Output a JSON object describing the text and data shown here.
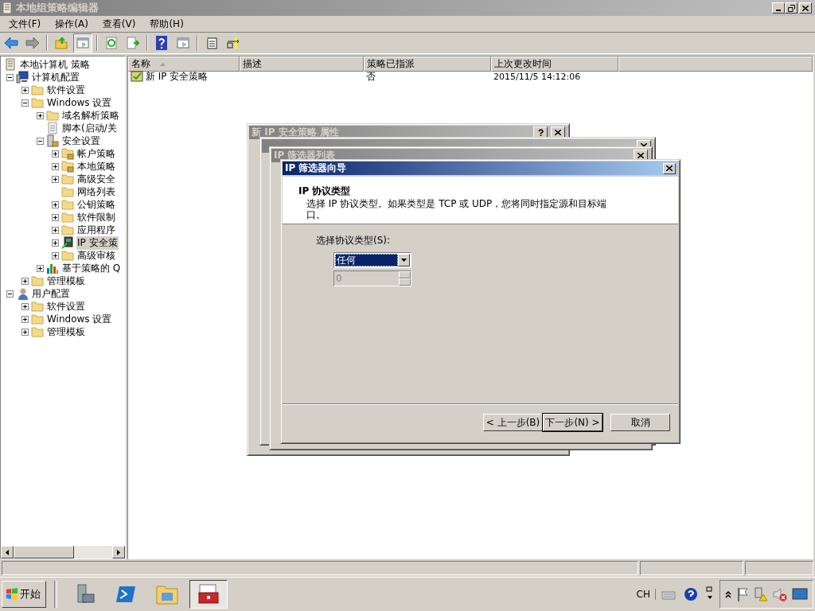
{
  "window": {
    "title": "本地组策略编辑器"
  },
  "menu": [
    {
      "label": "文件(F)"
    },
    {
      "label": "操作(A)"
    },
    {
      "label": "查看(V)"
    },
    {
      "label": "帮助(H)"
    }
  ],
  "toolbar": [
    {
      "kind": "back"
    },
    {
      "kind": "forward"
    },
    {
      "kind": "sep"
    },
    {
      "kind": "up"
    },
    {
      "kind": "pane",
      "selected": true
    },
    {
      "kind": "sep"
    },
    {
      "kind": "refresh"
    },
    {
      "kind": "export"
    },
    {
      "kind": "sep"
    },
    {
      "kind": "help"
    },
    {
      "kind": "pane2",
      "selected": false
    },
    {
      "kind": "sep"
    },
    {
      "kind": "newdoc"
    },
    {
      "kind": "assign"
    }
  ],
  "tree": [
    {
      "label": "本地计算机 策略",
      "kind": "policy",
      "selected": false,
      "children": [
        {
          "label": "计算机配置",
          "kind": "computer",
          "expanded": true,
          "selected": false,
          "children": [
            {
              "label": "软件设置",
              "kind": "folder",
              "expanded": false,
              "selected": false
            },
            {
              "label": "Windows 设置",
              "kind": "folder",
              "expanded": true,
              "selected": false,
              "children": [
                {
                  "label": "域名解析策略",
                  "kind": "folder",
                  "expanded": false,
                  "selected": false
                },
                {
                  "label": "脚本(启动/关",
                  "kind": "script",
                  "selected": false
                },
                {
                  "label": "安全设置",
                  "kind": "secure",
                  "expanded": true,
                  "selected": false,
                  "children": [
                    {
                      "label": "帐户策略",
                      "kind": "lockfolder",
                      "expanded": false,
                      "selected": false
                    },
                    {
                      "label": "本地策略",
                      "kind": "lockfolder",
                      "expanded": false,
                      "selected": false
                    },
                    {
                      "label": "高级安全",
                      "kind": "folder",
                      "expanded": false,
                      "selected": false
                    },
                    {
                      "label": "网络列表",
                      "kind": "folder",
                      "selected": false
                    },
                    {
                      "label": "公钥策略",
                      "kind": "folder",
                      "expanded": false,
                      "selected": false
                    },
                    {
                      "label": "软件限制",
                      "kind": "folder",
                      "expanded": false,
                      "selected": false
                    },
                    {
                      "label": "应用程序",
                      "kind": "folder",
                      "expanded": false,
                      "selected": false
                    },
                    {
                      "label": "IP 安全策",
                      "kind": "ipsec",
                      "expanded": false,
                      "selected": true
                    },
                    {
                      "label": "高级审核",
                      "kind": "folder",
                      "expanded": false,
                      "selected": false
                    }
                  ]
                },
                {
                  "label": "基于策略的 Q",
                  "kind": "chart",
                  "expanded": false,
                  "selected": false
                }
              ]
            },
            {
              "label": "管理模板",
              "kind": "folder",
              "expanded": false,
              "selected": false
            }
          ]
        },
        {
          "label": "用户配置",
          "kind": "user",
          "expanded": true,
          "selected": false,
          "children": [
            {
              "label": "软件设置",
              "kind": "folder",
              "expanded": false,
              "selected": false
            },
            {
              "label": "Windows 设置",
              "kind": "folder",
              "expanded": false,
              "selected": false
            },
            {
              "label": "管理模板",
              "kind": "folder",
              "expanded": false,
              "selected": false
            }
          ]
        }
      ]
    }
  ],
  "list": {
    "columns": [
      {
        "label": "名称",
        "sorted": true
      },
      {
        "label": "描述",
        "sorted": false
      },
      {
        "label": "策略已指派",
        "sorted": false
      },
      {
        "label": "上次更改时间",
        "sorted": false
      }
    ],
    "rows": [
      {
        "name": "新 IP 安全策略",
        "assigned": "否",
        "modified": "2015/11/5 14:12:06"
      }
    ]
  },
  "back_windows": [
    {
      "title": "新 IP 安全策略 属性"
    },
    {
      "title": "IP 筛选器列表"
    }
  ],
  "wizard": {
    "title": "IP 筛选器向导",
    "heading": "IP 协议类型",
    "description": "选择 IP 协议类型。如果类型是 TCP 或 UDP，您将同时指定源和目标端口。",
    "protocol_label": "选择协议类型(S):",
    "protocol": {
      "value": "任何"
    },
    "port": {
      "value": "0",
      "disabled": true
    },
    "buttons": [
      {
        "label": "< 上一步(B)",
        "default": false
      },
      {
        "label": "下一步(N) >",
        "default": true
      },
      {
        "label": "取消",
        "default": false
      }
    ]
  },
  "taskbar": {
    "start": "开始",
    "apps": [
      {
        "kind": "server",
        "selected": false
      },
      {
        "kind": "shell",
        "selected": false
      },
      {
        "kind": "explorer",
        "selected": false
      },
      {
        "kind": "toolbox",
        "selected": true
      }
    ],
    "language": "CH"
  }
}
